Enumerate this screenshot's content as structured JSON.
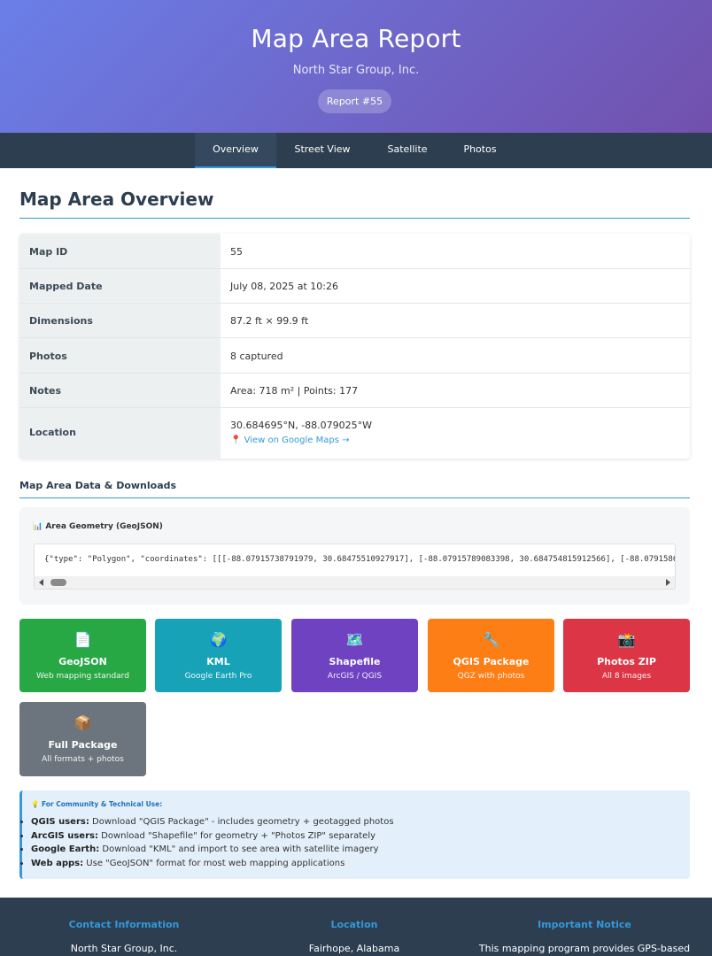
{
  "header": {
    "title": "Map Area Report",
    "company": "North Star Group, Inc.",
    "badge": "Report #55",
    "gradient": [
      "#6a7fe8",
      "#7250ad"
    ]
  },
  "nav": {
    "tabs": [
      {
        "label": "Overview",
        "active": true
      },
      {
        "label": "Street View",
        "active": false
      },
      {
        "label": "Satellite",
        "active": false
      },
      {
        "label": "Photos",
        "active": false
      }
    ]
  },
  "overview": {
    "title": "Map Area Overview",
    "rows": [
      {
        "label": "Map ID",
        "value": "55"
      },
      {
        "label": "Mapped Date",
        "value": "July 08, 2025 at 10:26"
      },
      {
        "label": "Dimensions",
        "value": "87.2 ft × 99.9 ft"
      },
      {
        "label": "Photos",
        "value": "8 captured"
      },
      {
        "label": "Notes",
        "value": "Area: 718 m² | Points: 177"
      },
      {
        "label": "Location",
        "value": "30.684695°N, -88.079025°W",
        "link": "📍 View on Google Maps →"
      }
    ]
  },
  "downloads": {
    "title": "Map Area Data & Downloads",
    "geometry_title": "📊 Area Geometry (GeoJSON)",
    "geometry_code": "{\"type\": \"Polygon\", \"coordinates\": [[[-88.07915738791979, 30.68475510927917], [-88.07915789083398, 30.684754815912566], [-88.0791586...",
    "buttons": [
      {
        "icon": "📄",
        "icon_name": "document-icon",
        "name": "GeoJSON",
        "desc": "Web mapping standard",
        "color": "#28a745"
      },
      {
        "icon": "🌍",
        "icon_name": "globe-icon",
        "name": "KML",
        "desc": "Google Earth Pro",
        "color": "#17a2b8"
      },
      {
        "icon": "🗺️",
        "icon_name": "map-icon",
        "name": "Shapefile",
        "desc": "ArcGIS / QGIS",
        "color": "#6f42c1"
      },
      {
        "icon": "🔧",
        "icon_name": "wrench-icon",
        "name": "QGIS Package",
        "desc": "QGZ with photos",
        "color": "#fd7e14"
      },
      {
        "icon": "📸",
        "icon_name": "camera-icon",
        "name": "Photos ZIP",
        "desc": "All 8 images",
        "color": "#dc3545"
      },
      {
        "icon": "📦",
        "icon_name": "package-icon",
        "name": "Full Package",
        "desc": "All formats + photos",
        "color": "#6c757d"
      }
    ]
  },
  "tips": {
    "title": "💡 For Community & Technical Use:",
    "items": [
      {
        "strong": "QGIS users:",
        "text": " Download \"QGIS Package\" - includes geometry + geotagged photos"
      },
      {
        "strong": "ArcGIS users:",
        "text": " Download \"Shapefile\" for geometry + \"Photos ZIP\" separately"
      },
      {
        "strong": "Google Earth:",
        "text": " Download \"KML\" and import to see area with satellite imagery"
      },
      {
        "strong": "Web apps:",
        "text": " Use \"GeoJSON\" format for most web mapping applications"
      }
    ]
  },
  "footer": {
    "columns": [
      {
        "heading": "Contact Information",
        "text": "North Star Group, Inc."
      },
      {
        "heading": "Location",
        "text": "Fairhope, Alabama"
      },
      {
        "heading": "Important Notice",
        "text": "This mapping program provides GPS-based"
      }
    ]
  }
}
